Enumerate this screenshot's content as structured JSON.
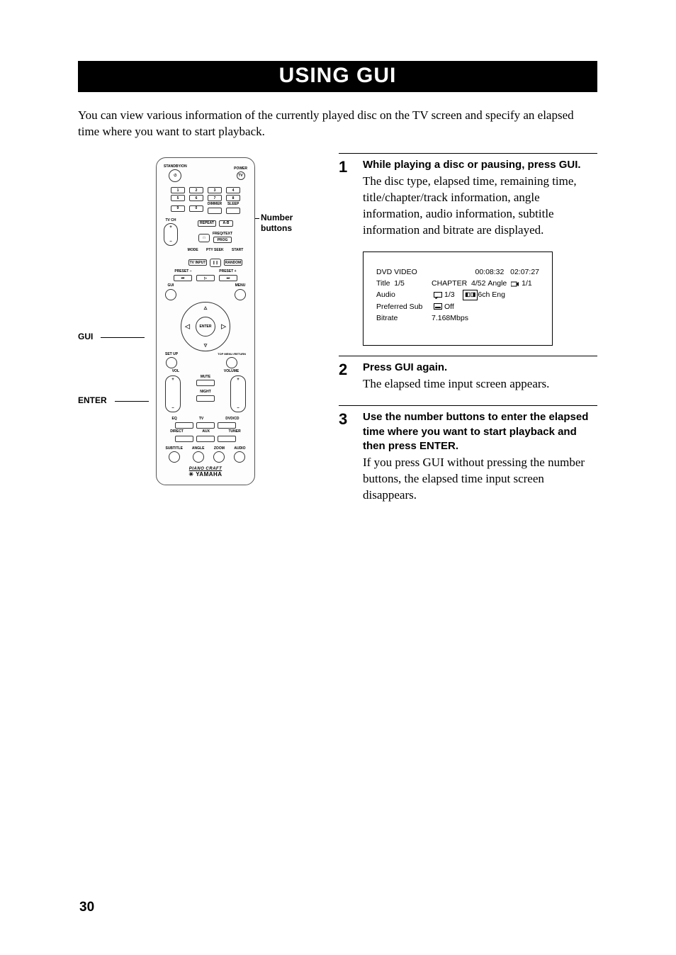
{
  "page": {
    "title": "USING GUI",
    "intro": "You can view various information of the currently played disc on the TV screen and specify an elapsed time where you want to start playback.",
    "pageNumber": "30"
  },
  "callouts": {
    "gui": "GUI",
    "enter": "ENTER",
    "numberButtons": "Number buttons"
  },
  "remote": {
    "standbyLabel": "STANDBY/ON",
    "powerLabel": "POWER",
    "tv": "TV",
    "num1": "1",
    "num2": "2",
    "num3": "3",
    "num4": "4",
    "num5": "5",
    "num6": "6",
    "num7": "7",
    "num8": "8",
    "num9": "9",
    "num0": "0",
    "dimmer": "DIMMER",
    "sleep": "SLEEP",
    "tvch": "TV CH",
    "plus": "+",
    "minus": "–",
    "repeat": "REPEAT",
    "ab": "A-B",
    "freqText": "FREQ/TEXT",
    "stopSymbol": "□",
    "prog": "PROG",
    "mode": "MODE",
    "ptySeek": "PTY SEEK",
    "start": "START",
    "tvInput": "TV INPUT",
    "pauseSymbol": "❙❙",
    "random": "RANDOM",
    "presetMinus": "PRESET –",
    "presetPlus": "PRESET +",
    "prevSymbol": "⏮",
    "playSymbol": "▷",
    "nextSymbol": "⏭",
    "gui": "GUI",
    "menu": "MENU",
    "enter": "ENTER",
    "setup": "SET UP",
    "topMenu": "TOP MENU /RETURN",
    "vol": "VOL",
    "volume": "VOLUME",
    "mute": "MUTE",
    "night": "NIGHT",
    "eq": "EQ",
    "tvSel": "TV",
    "dvdcd": "DVD/CD",
    "direct": "DIRECT",
    "aux": "AUX",
    "tuner": "TUNER",
    "subtitle": "SUBTITLE",
    "angle": "ANGLE",
    "zoom": "ZOOM",
    "audio": "AUDIO",
    "pianoCraft": "PIANO CRAFT",
    "brand": "YAMAHA"
  },
  "steps": [
    {
      "num": "1",
      "title": "While playing a disc or pausing, press GUI.",
      "text": "The disc type, elapsed time, remaining time, title/chapter/track information, angle information, audio information, subtitle information and bitrate are displayed."
    },
    {
      "num": "2",
      "title": "Press GUI again.",
      "text": "The elapsed time input screen appears."
    },
    {
      "num": "3",
      "title": "Use the number buttons to enter the elapsed time where you want to start playback and then press ENTER.",
      "text": "If you press GUI without pressing the number buttons, the elapsed time input screen disappears."
    }
  ],
  "osd": {
    "discType": "DVD VIDEO",
    "elapsed": "00:08:32",
    "remaining": "02:07:27",
    "titleLabel": "Title",
    "titleValue": "1/5",
    "chapterLabel": "CHAPTER",
    "chapterValue": "4/52",
    "angleLabel": "Angle",
    "angleValue": "1/1",
    "audioLabel": "Audio",
    "audioValue": "1/3",
    "audioFormat": "6ch Eng",
    "prefSubLabel": "Preferred Sub",
    "prefSubValue": "Off",
    "bitrateLabel": "Bitrate",
    "bitrateValue": "7.168Mbps"
  }
}
